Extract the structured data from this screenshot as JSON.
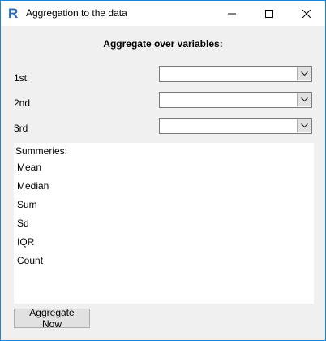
{
  "window": {
    "title": "Aggregation to the data"
  },
  "titlebar": {
    "app_icon": "R-logo-icon",
    "minimize_icon": "minimize-icon",
    "maximize_icon": "maximize-icon",
    "close_icon": "close-icon"
  },
  "main": {
    "heading": "Aggregate over variables:",
    "variables": [
      {
        "label": "1st",
        "value": ""
      },
      {
        "label": "2nd",
        "value": ""
      },
      {
        "label": "3rd",
        "value": ""
      }
    ],
    "summaries": {
      "caption": "Summeries:",
      "items": [
        "Mean",
        "Median",
        "Sum",
        "Sd",
        "IQR",
        "Count"
      ]
    },
    "aggregate_button": "Aggregate Now"
  },
  "colors": {
    "window_border": "#1883d7",
    "background": "#f0f0f0",
    "r_logo": "#2369bc"
  }
}
